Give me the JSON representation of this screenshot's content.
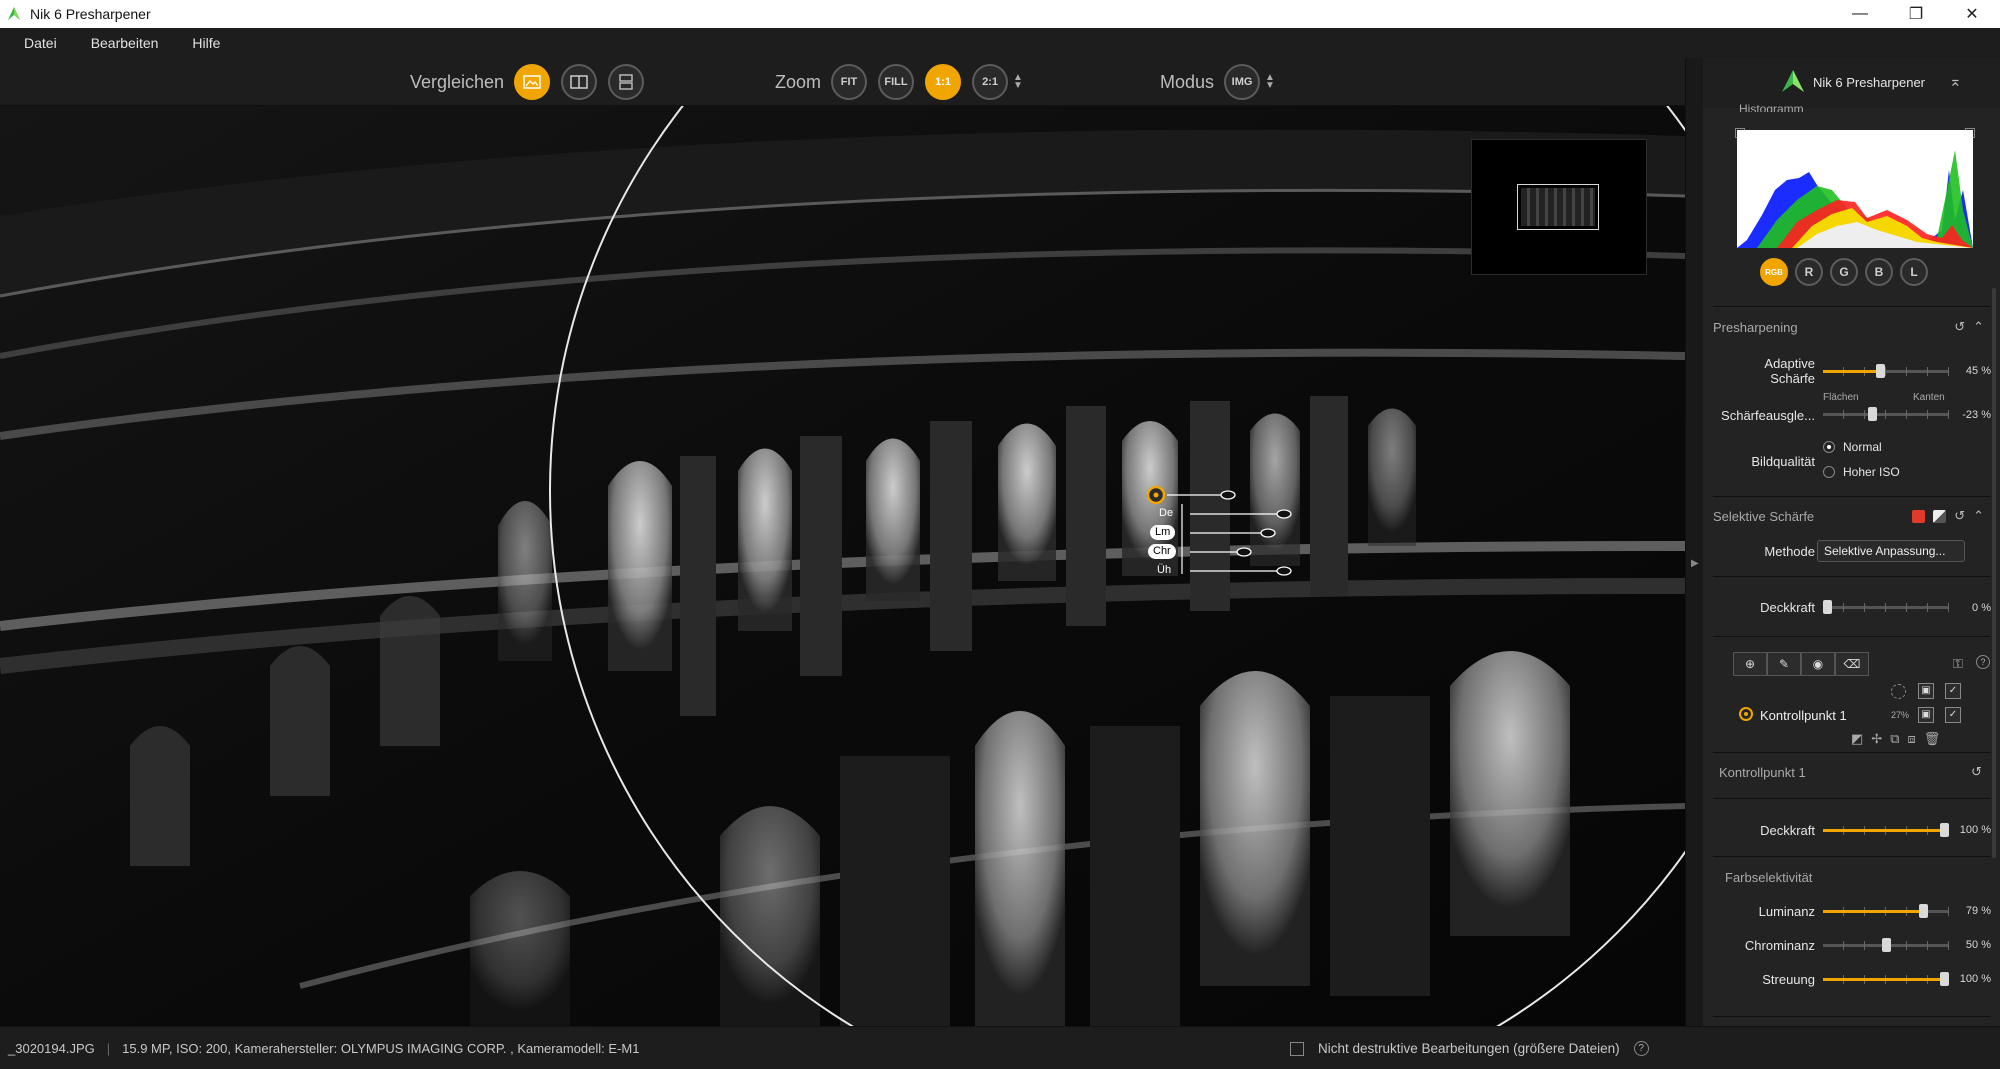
{
  "window": {
    "title": "Nik 6 Presharpener",
    "minimize": "—",
    "maximize": "❐",
    "close": "✕"
  },
  "menu": [
    "Datei",
    "Bearbeiten",
    "Hilfe"
  ],
  "toolbar": {
    "compare_label": "Vergleichen",
    "zoom_label": "Zoom",
    "zoom_options": [
      "FIT",
      "FILL",
      "1:1",
      "2:1"
    ],
    "zoom_active": "1:1",
    "mode_label": "Modus",
    "mode_value": "IMG",
    "compare_active": 0
  },
  "control_point_overlay": {
    "labels": [
      "De",
      "Lm",
      "Chr",
      "Üh"
    ]
  },
  "panel": {
    "product_name": "Nik 6 Presharpener",
    "histogram_title": "Histogramm",
    "channels": [
      "RGB",
      "R",
      "G",
      "B",
      "L"
    ],
    "channel_active": "RGB",
    "presharpening": {
      "title": "Presharpening",
      "adaptive_label_1": "Adaptive",
      "adaptive_label_2": "Schärfe",
      "adaptive_value_text": "45 %",
      "adaptive_value": 45,
      "balance_label": "Schärfeausgle...",
      "balance_left": "Flächen",
      "balance_right": "Kanten",
      "balance_value_text": "-23 %",
      "balance_value": -23,
      "quality_label": "Bildqualität",
      "quality_options": [
        "Normal",
        "Hoher ISO"
      ],
      "quality_selected": "Normal"
    },
    "selective": {
      "title": "Selektive Schärfe",
      "method_label": "Methode",
      "method_value": "Selektive Anpassung...",
      "opacity_label": "Deckkraft",
      "opacity_value_text": "0 %",
      "opacity_value": 0,
      "control_point_name": "Kontrollpunkt 1",
      "control_point_percent": "27%",
      "selected_cp_title": "Kontrollpunkt 1",
      "cp_opacity_label": "Deckkraft",
      "cp_opacity_value_text": "100 %",
      "cp_opacity_value": 100,
      "color_sel_title": "Farbselektivität",
      "luminance_label": "Luminanz",
      "luminance_value_text": "79 %",
      "luminance_value": 79,
      "chrominance_label": "Chrominanz",
      "chrominance_value_text": "50 %",
      "chrominance_value": 50,
      "spread_label": "Streuung",
      "spread_value_text": "100 %",
      "spread_value": 100
    }
  },
  "status": {
    "filename": "_3020194.JPG",
    "info": "15.9 MP, ISO: 200, Kamerahersteller: OLYMPUS IMAGING CORP.  , Kameramodell: E-M1",
    "nondestructive_label": "Nicht destruktive Bearbeitungen (größere Dateien)",
    "help": "?"
  },
  "colors": {
    "accent": "#f0a500",
    "panel_bg": "#232323",
    "toolbar_bg": "#1d1d1d"
  }
}
